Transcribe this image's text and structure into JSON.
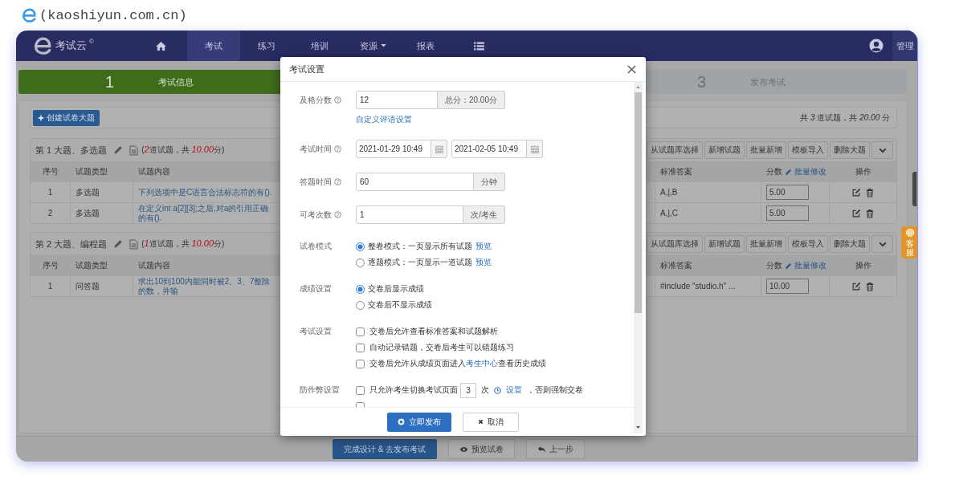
{
  "caption": {
    "text": "(kaoshiyun.com.cn)"
  },
  "navbar": {
    "brand": "考试云",
    "brand_mark": "©",
    "items": [
      {
        "kind": "home",
        "selected": false
      },
      {
        "kind": "text",
        "label": "考试",
        "selected": true
      },
      {
        "kind": "text",
        "label": "练习",
        "selected": false
      },
      {
        "kind": "text",
        "label": "培训",
        "selected": false
      },
      {
        "kind": "dropdown",
        "label": "资源",
        "selected": false
      },
      {
        "kind": "text",
        "label": "报表",
        "selected": false
      },
      {
        "kind": "menu",
        "selected": false
      }
    ],
    "user_menu": "管理"
  },
  "steps": [
    {
      "number": "1",
      "label": "考试信息",
      "selected": true
    },
    {
      "number": "3",
      "label": "发布考试",
      "selected": false
    }
  ],
  "toolbar": {
    "create_button": "创建试卷大题",
    "summary": "共 *3* 道试题，共 *20.00* 分"
  },
  "sections": [
    {
      "title": "第 1 大题、多选题",
      "summary": {
        "before": "(",
        "count": "2",
        "middle": "道试题，共 ",
        "points": "10.00",
        "after": "分)"
      },
      "actions": [
        "从试题库选择",
        "新增试题",
        "批量新增",
        "模板导入",
        "删除大题"
      ],
      "columns": [
        {
          "label": "序号"
        },
        {
          "label": "试题类型"
        },
        {
          "label": "试题内容"
        },
        {
          "label": "标准答案"
        },
        {
          "label": "分数",
          "link": "批量修改"
        },
        {
          "label": "操作"
        }
      ],
      "rows": [
        {
          "number": "1",
          "type": "多选题",
          "content": "下列选项中是C语言合法标志符的有().",
          "answer": "A,|,B",
          "score": "5.00"
        },
        {
          "number": "2",
          "type": "多选题",
          "content": "在定义int a[2][3];之后,对a的引用正确的有().",
          "answer": "A,|,C",
          "score": "5.00"
        }
      ]
    },
    {
      "title": "第 2 大题、编程题",
      "summary": {
        "before": "(",
        "count": "1",
        "middle": "道试题，共 ",
        "points": "10.00",
        "after": "分)"
      },
      "actions": [
        "从试题库选择",
        "新增试题",
        "批量新增",
        "模板导入",
        "删除大题"
      ],
      "columns": [
        {
          "label": "序号"
        },
        {
          "label": "试题类型"
        },
        {
          "label": "试题内容"
        },
        {
          "label": "标准答案"
        },
        {
          "label": "分数",
          "link": "批量修改"
        },
        {
          "label": "操作"
        }
      ],
      "rows": [
        {
          "number": "1",
          "type": "问答题",
          "content": "求出10到100内能同时被2、3、7整除的数，并输",
          "answer": "#include \"studio.h\" ...",
          "score": "10.00"
        }
      ]
    }
  ],
  "footer_buttons": [
    {
      "kind": "primary",
      "label": "完成设计 & 去发布考试"
    },
    {
      "kind": "preview",
      "label": "预览试卷"
    },
    {
      "kind": "back",
      "label": "上一步"
    }
  ],
  "support_tab": "客服",
  "modal": {
    "title": "考试设置",
    "fields": [
      {
        "kind": "input",
        "label": "及格分数",
        "help": true,
        "value": "12",
        "addon": "总分：20.00分",
        "link": "自定义评语设置"
      },
      {
        "kind": "dates",
        "label": "考试时间",
        "help": true,
        "values": [
          "2021-01-29 10:49",
          "2021-02-05 10:49"
        ]
      },
      {
        "kind": "input",
        "label": "答题时间",
        "help": true,
        "value": "60",
        "addon": "分钟"
      },
      {
        "kind": "input",
        "label": "可考次数",
        "help": true,
        "value": "1",
        "addon": "次/考生"
      },
      {
        "kind": "radio",
        "label": "试卷模式",
        "help": false,
        "options": [
          {
            "text": "整卷模式：一页显示所有试题",
            "link": "预览",
            "selected": true
          },
          {
            "text": "逐题模式：一页显示一道试题",
            "link": "预览",
            "selected": false
          }
        ]
      },
      {
        "kind": "radio",
        "label": "成绩设置",
        "help": false,
        "options": [
          {
            "text": "交卷后显示成绩",
            "selected": true
          },
          {
            "text": "交卷后不显示成绩",
            "selected": false
          }
        ]
      },
      {
        "kind": "check",
        "label": "考试设置",
        "help": false,
        "options": [
          {
            "text": "交卷后允许查看标准答案和试题解析",
            "checked": false
          },
          {
            "text": "自动记录错题，交卷后考生可以错题练习",
            "checked": false
          },
          {
            "text": "交卷后允许从成绩页面进入",
            "link": "考生中心",
            "text_after": "查看历史成绩",
            "checked": false
          }
        ]
      },
      {
        "kind": "anticheat",
        "label": "防作弊设置",
        "help": false,
        "options": [
          {
            "text": "只允许考生切换考试页面",
            "count": "3",
            "unit": "次",
            "link": "设置",
            "text_after": "，否则强制交卷",
            "checked": false
          },
          {
            "checked": false
          }
        ]
      }
    ],
    "buttons": [
      {
        "kind": "primary",
        "label": "立即发布"
      },
      {
        "kind": "cancel",
        "label": "取消"
      }
    ]
  }
}
